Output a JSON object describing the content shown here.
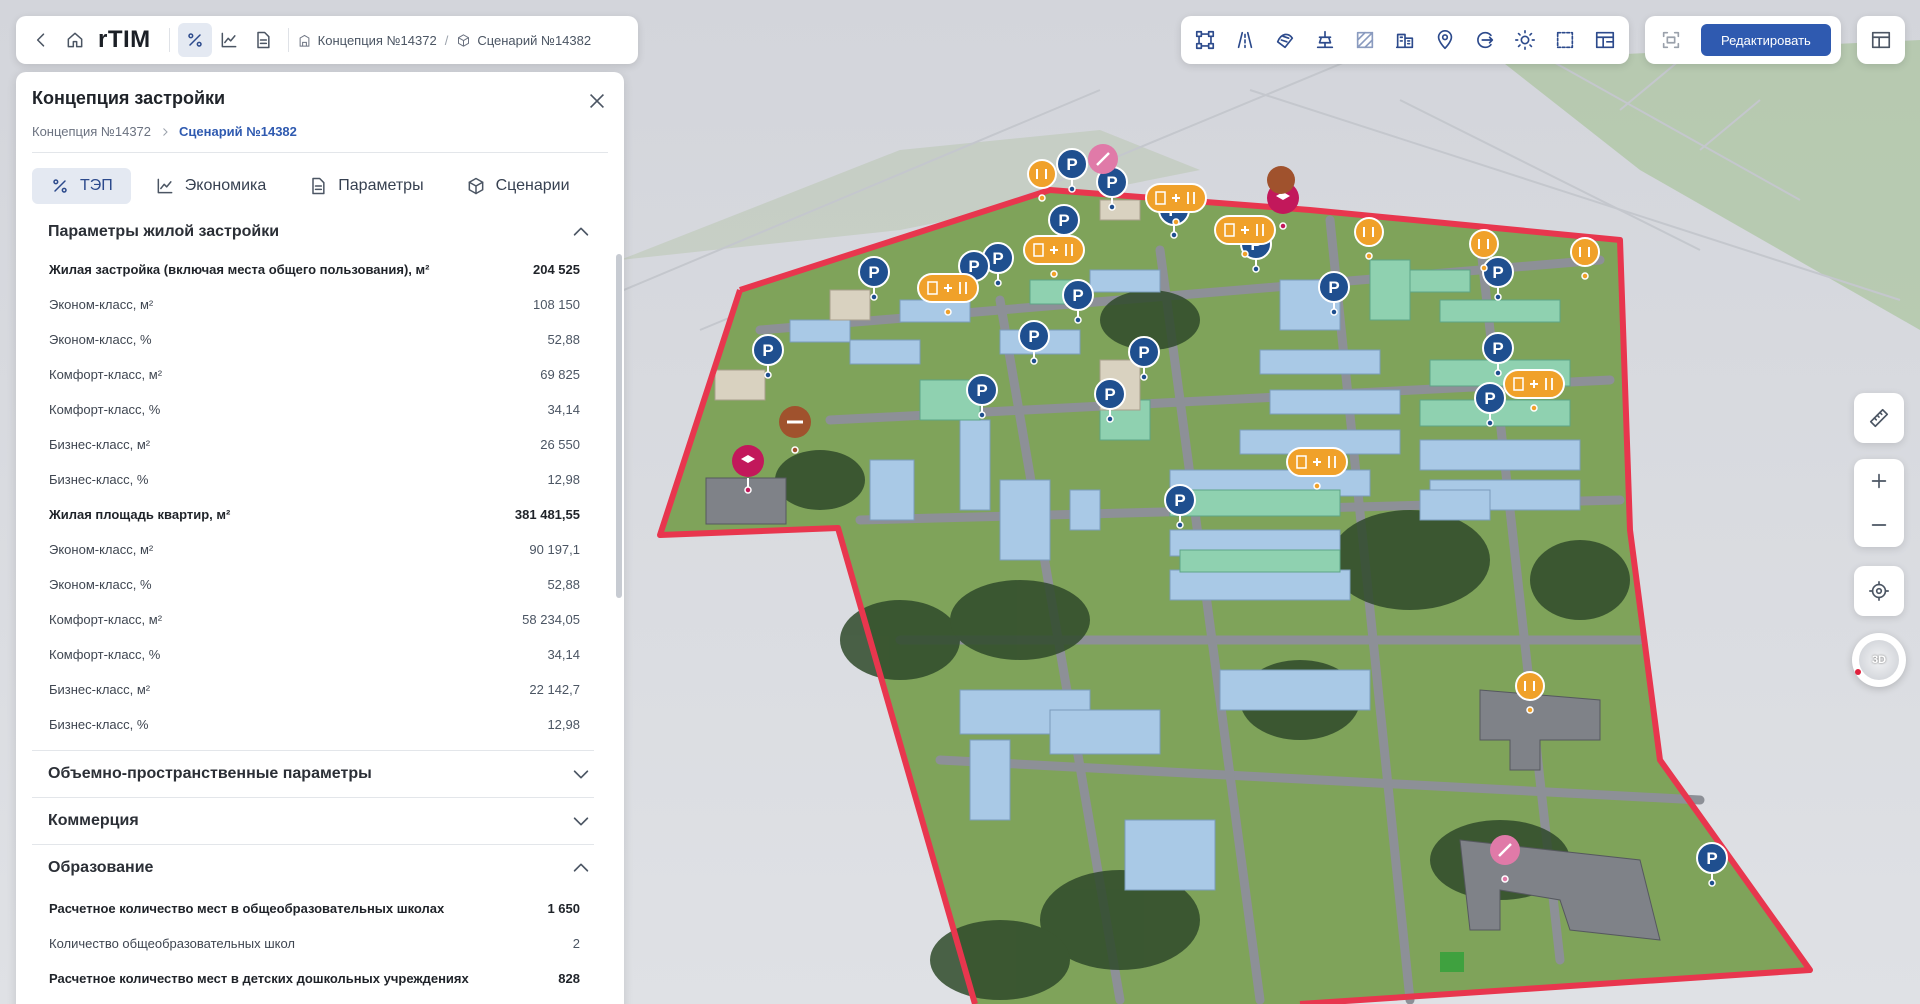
{
  "nav": {
    "logo": "rTIM",
    "crumb_concept": "Концепция №14372",
    "crumb_sep": "/",
    "crumb_scenario": "Сценарий №14382"
  },
  "toolbar": {
    "edit_label": "Редактировать",
    "tools": [
      "polygon-select-icon",
      "road-icon",
      "landscape-icon",
      "engineering-icon",
      "texture-icon",
      "buildings-icon",
      "location-pin-icon",
      "transport-icon",
      "sun-icon",
      "area-icon",
      "layout-icon"
    ]
  },
  "panel": {
    "title": "Концепция застройки",
    "breadcrumb_concept": "Концепция №14372",
    "breadcrumb_scenario": "Сценарий №14382",
    "tabs": [
      {
        "label": "ТЭП",
        "icon": "percent-icon",
        "active": true
      },
      {
        "label": "Экономика",
        "icon": "chart-line-icon",
        "active": false
      },
      {
        "label": "Параметры",
        "icon": "document-icon",
        "active": false
      },
      {
        "label": "Сценарии",
        "icon": "cube-icon",
        "active": false
      }
    ],
    "sections": [
      {
        "title": "Параметры жилой застройки",
        "expanded": true,
        "rows": [
          {
            "label": "Жилая застройка (включая места общего пользования), м²",
            "value": "204 525",
            "bold": true
          },
          {
            "label": "Эконом-класс, м²",
            "value": "108 150",
            "bold": false
          },
          {
            "label": "Эконом-класс, %",
            "value": "52,88",
            "bold": false
          },
          {
            "label": "Комфорт-класс, м²",
            "value": "69 825",
            "bold": false
          },
          {
            "label": "Комфорт-класс, %",
            "value": "34,14",
            "bold": false
          },
          {
            "label": "Бизнес-класс, м²",
            "value": "26 550",
            "bold": false
          },
          {
            "label": "Бизнес-класс, %",
            "value": "12,98",
            "bold": false
          },
          {
            "label": "Жилая площадь квартир, м²",
            "value": "381 481,55",
            "bold": true
          },
          {
            "label": "Эконом-класс, м²",
            "value": "90 197,1",
            "bold": false
          },
          {
            "label": "Эконом-класс, %",
            "value": "52,88",
            "bold": false
          },
          {
            "label": "Комфорт-класс, м²",
            "value": "58 234,05",
            "bold": false
          },
          {
            "label": "Комфорт-класс, %",
            "value": "34,14",
            "bold": false
          },
          {
            "label": "Бизнес-класс, м²",
            "value": "22 142,7",
            "bold": false
          },
          {
            "label": "Бизнес-класс, %",
            "value": "12,98",
            "bold": false
          }
        ]
      },
      {
        "title": "Объемно-пространственные параметры",
        "expanded": false,
        "rows": []
      },
      {
        "title": "Коммерция",
        "expanded": false,
        "rows": []
      },
      {
        "title": "Образование",
        "expanded": true,
        "rows": [
          {
            "label": "Расчетное количество мест в общеобразовательных школах",
            "value": "1 650",
            "bold": true
          },
          {
            "label": "Количество общеобразовательных школ",
            "value": "2",
            "bold": false
          },
          {
            "label": "Расчетное количество мест в детских дошкольных учреждениях",
            "value": "828",
            "bold": true
          }
        ]
      }
    ]
  },
  "map": {
    "compass_label": "3D",
    "marker_parking_label": "P",
    "colors": {
      "boundary": "#e8364e",
      "parking": "#1f4f8f",
      "food": "#f0a12a",
      "school": "#c2185b",
      "clinic": "#e07aa8",
      "sport": "#a0522d",
      "grass": "#7fa35a",
      "building_blue": "#a9c9e6",
      "building_green": "#8fd1b0"
    }
  }
}
